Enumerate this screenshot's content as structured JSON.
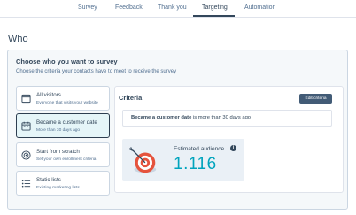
{
  "tabs": [
    {
      "label": "Survey"
    },
    {
      "label": "Feedback"
    },
    {
      "label": "Thank you"
    },
    {
      "label": "Targeting",
      "active": true
    },
    {
      "label": "Automation"
    }
  ],
  "section_title": "Who",
  "card": {
    "title": "Choose who you want to survey",
    "subtitle": "Choose the criteria your contacts have to meet to receive the survey"
  },
  "options": [
    {
      "title": "All visitors",
      "description": "Everyone that visits your website",
      "icon": "browser-icon",
      "selected": false
    },
    {
      "title": "Became a customer date",
      "description": "More than 30 days ago",
      "icon": "calendar-icon",
      "selected": true
    },
    {
      "title": "Start from scratch",
      "description": "Set your own enrollment criteria",
      "icon": "target-icon",
      "selected": false
    },
    {
      "title": "Static lists",
      "description": "Existing marketing lists",
      "icon": "list-icon",
      "selected": false
    }
  ],
  "criteria": {
    "title": "Criteria",
    "edit_label": "Edit criteria",
    "rule_property": "Became a customer date",
    "rule_rest": " is more than 30 days ago"
  },
  "audience": {
    "label": "Estimated audience",
    "info_glyph": "i",
    "value": "1.116"
  },
  "colors": {
    "accent": "#00a4bd",
    "selected_bg": "#e5f5f8",
    "button_bg": "#425b76",
    "target_red": "#e5533d"
  }
}
